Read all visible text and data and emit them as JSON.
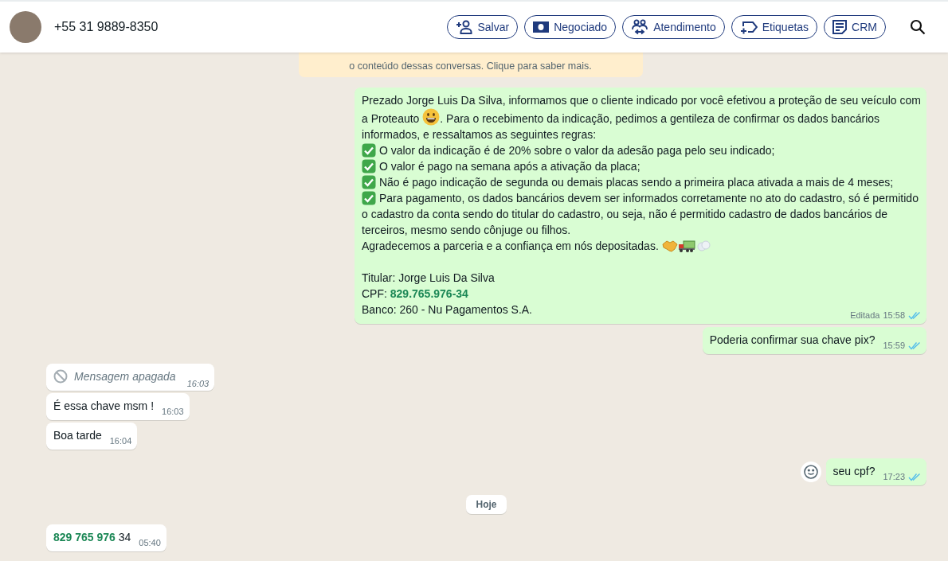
{
  "header": {
    "contact": "+55 31 9889-8350",
    "actions": [
      {
        "kind": "save",
        "label": "Salvar"
      },
      {
        "kind": "deal",
        "label": "Negociado"
      },
      {
        "kind": "service",
        "label": "Atendimento"
      },
      {
        "kind": "labels",
        "label": "Etiquetas"
      },
      {
        "kind": "crm",
        "label": "CRM"
      }
    ]
  },
  "notice": {
    "text": "o conteúdo dessas conversas. Clique para saber mais."
  },
  "messages": [
    {
      "kind": "message",
      "outgoing": true,
      "edited": "Editada",
      "time": "15:58",
      "read": true,
      "paragraphs": [
        {
          "segments": [
            {
              "kind": "text",
              "text": "Prezado Jorge Luis Da Silva, informamos que o cliente indicado por você efetivou a proteção de seu veículo com a Proteauto "
            },
            {
              "kind": "smile"
            },
            {
              "kind": "text",
              "text": ". Para o recebimento da indicação, pedimos a gentileza de confirmar os dados bancários informados, e  ressaltamos as seguintes regras:"
            }
          ]
        },
        {
          "segments": [
            {
              "kind": "check"
            },
            {
              "kind": "text",
              "text": " O valor da indicação é de 20% sobre o valor da adesão paga pelo seu indicado;"
            }
          ]
        },
        {
          "segments": [
            {
              "kind": "check"
            },
            {
              "kind": "text",
              "text": " O valor é pago na semana após a ativação da placa;"
            }
          ]
        },
        {
          "segments": [
            {
              "kind": "check"
            },
            {
              "kind": "text",
              "text": " Não é pago indicação de segunda ou demais placas sendo a primeira placa ativada a mais de 4 meses;"
            }
          ]
        },
        {
          "segments": [
            {
              "kind": "check"
            },
            {
              "kind": "text",
              "text": " Para pagamento, os dados bancários devem ser informados corretamente no ato do cadastro, só é permitido o cadastro da conta sendo do titular do cadastro, ou seja, não é permitido cadastro de dados bancários de terceiros, mesmo sendo cônjuge ou filhos."
            }
          ]
        },
        {
          "segments": [
            {
              "kind": "text",
              "text": "Agradecemos a parceria e a confiança em nós depositadas. "
            },
            {
              "kind": "handshake"
            },
            {
              "kind": "truck"
            },
            {
              "kind": "dash"
            }
          ]
        },
        {
          "gap_before": true,
          "segments": [
            {
              "kind": "text",
              "text": "Titular: Jorge Luis Da Silva"
            }
          ]
        },
        {
          "segments": [
            {
              "kind": "text",
              "text": "CPF: **829.765.976-34**"
            }
          ]
        },
        {
          "segments": [
            {
              "kind": "text",
              "text": "Banco: 260 - Nu Pagamentos S.A."
            }
          ]
        }
      ]
    },
    {
      "kind": "message",
      "outgoing": true,
      "time": "15:59",
      "read": true,
      "paragraphs": [
        {
          "segments": [
            {
              "kind": "text",
              "text": "Poderia confirmar sua chave pix?"
            }
          ]
        }
      ]
    },
    {
      "kind": "deleted",
      "outgoing": false,
      "time": "16:03",
      "text": "Mensagem apagada"
    },
    {
      "kind": "message",
      "outgoing": false,
      "time": "16:03",
      "paragraphs": [
        {
          "segments": [
            {
              "kind": "text",
              "text": "É essa chave msm !"
            }
          ]
        }
      ]
    },
    {
      "kind": "message",
      "outgoing": false,
      "time": "16:04",
      "paragraphs": [
        {
          "segments": [
            {
              "kind": "text",
              "text": "Boa tarde"
            }
          ]
        }
      ]
    },
    {
      "kind": "message",
      "outgoing": true,
      "time": "17:23",
      "read": true,
      "reaction_button": true,
      "paragraphs": [
        {
          "segments": [
            {
              "kind": "text",
              "text": "seu cpf?"
            }
          ]
        }
      ]
    },
    {
      "kind": "day",
      "text": "Hoje"
    },
    {
      "kind": "message",
      "outgoing": false,
      "time": "05:40",
      "paragraphs": [
        {
          "segments": [
            {
              "kind": "text",
              "text": "**829 765 976** 34"
            }
          ]
        }
      ]
    }
  ]
}
